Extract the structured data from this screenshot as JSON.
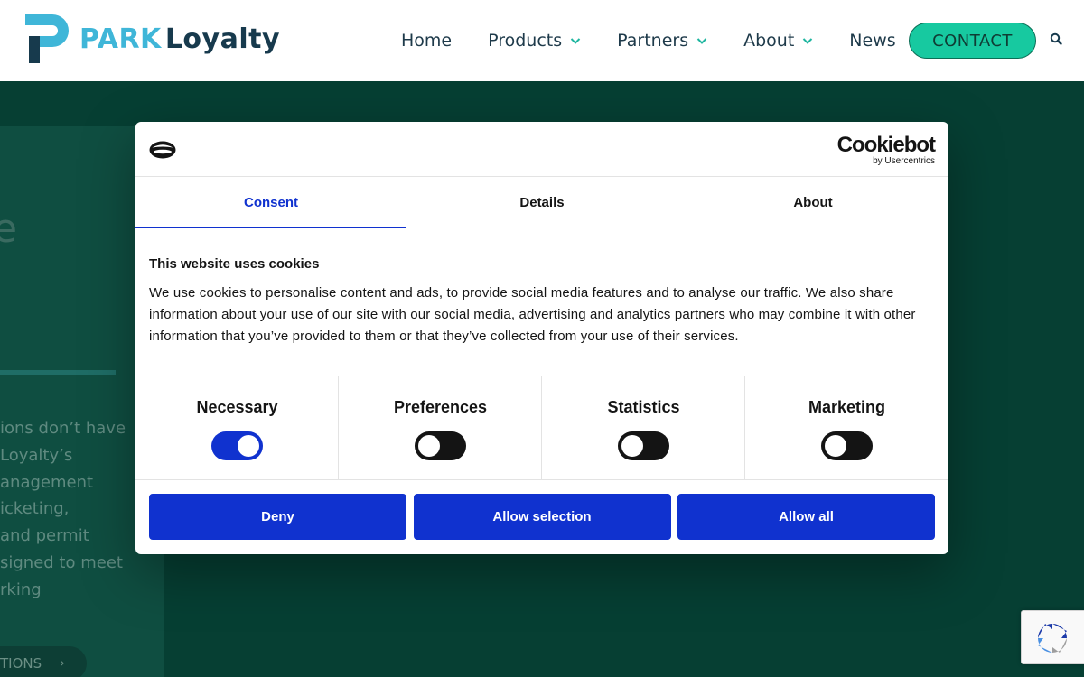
{
  "header": {
    "logo": {
      "park": "PARK",
      "loyalty": "Loyalty",
      "icon": "park-logo-icon"
    },
    "nav": [
      {
        "label": "Home",
        "dropdown": false
      },
      {
        "label": "Products",
        "dropdown": true
      },
      {
        "label": "Partners",
        "dropdown": true
      },
      {
        "label": "About",
        "dropdown": true
      },
      {
        "label": "News",
        "dropdown": false
      }
    ],
    "contact_label": "CONTACT",
    "search_icon": "search-icon"
  },
  "hero": {
    "heading_fragment": "e",
    "text_lines": [
      "ions don’t have",
      " Loyalty’s",
      "anagement",
      "icketing,",
      " and permit",
      "signed to meet",
      "rking"
    ],
    "cta_label": "TIONS",
    "cta_arrow": "›"
  },
  "cookie_dialog": {
    "brand": {
      "name": "Cookiebot",
      "by": "by Usercentrics"
    },
    "tabs": [
      {
        "label": "Consent",
        "active": true
      },
      {
        "label": "Details",
        "active": false
      },
      {
        "label": "About",
        "active": false
      }
    ],
    "title": "This website uses cookies",
    "description": "We use cookies to personalise content and ads, to provide social media features and to analyse our traffic. We also share information about your use of our site with our social media, advertising and analytics partners who may combine it with other information that you’ve provided to them or that they’ve collected from your use of their services.",
    "categories": [
      {
        "label": "Necessary",
        "enabled": true
      },
      {
        "label": "Preferences",
        "enabled": false
      },
      {
        "label": "Statistics",
        "enabled": false
      },
      {
        "label": "Marketing",
        "enabled": false
      }
    ],
    "buttons": {
      "deny": "Deny",
      "allow_selection": "Allow selection",
      "allow_all": "Allow all"
    }
  },
  "colors": {
    "accent": "#1032cf",
    "contact_button": "#17c9a0",
    "hero_background": "#063f33",
    "logo_park": "#3fb6d8",
    "logo_loyalty": "#173a4d"
  }
}
